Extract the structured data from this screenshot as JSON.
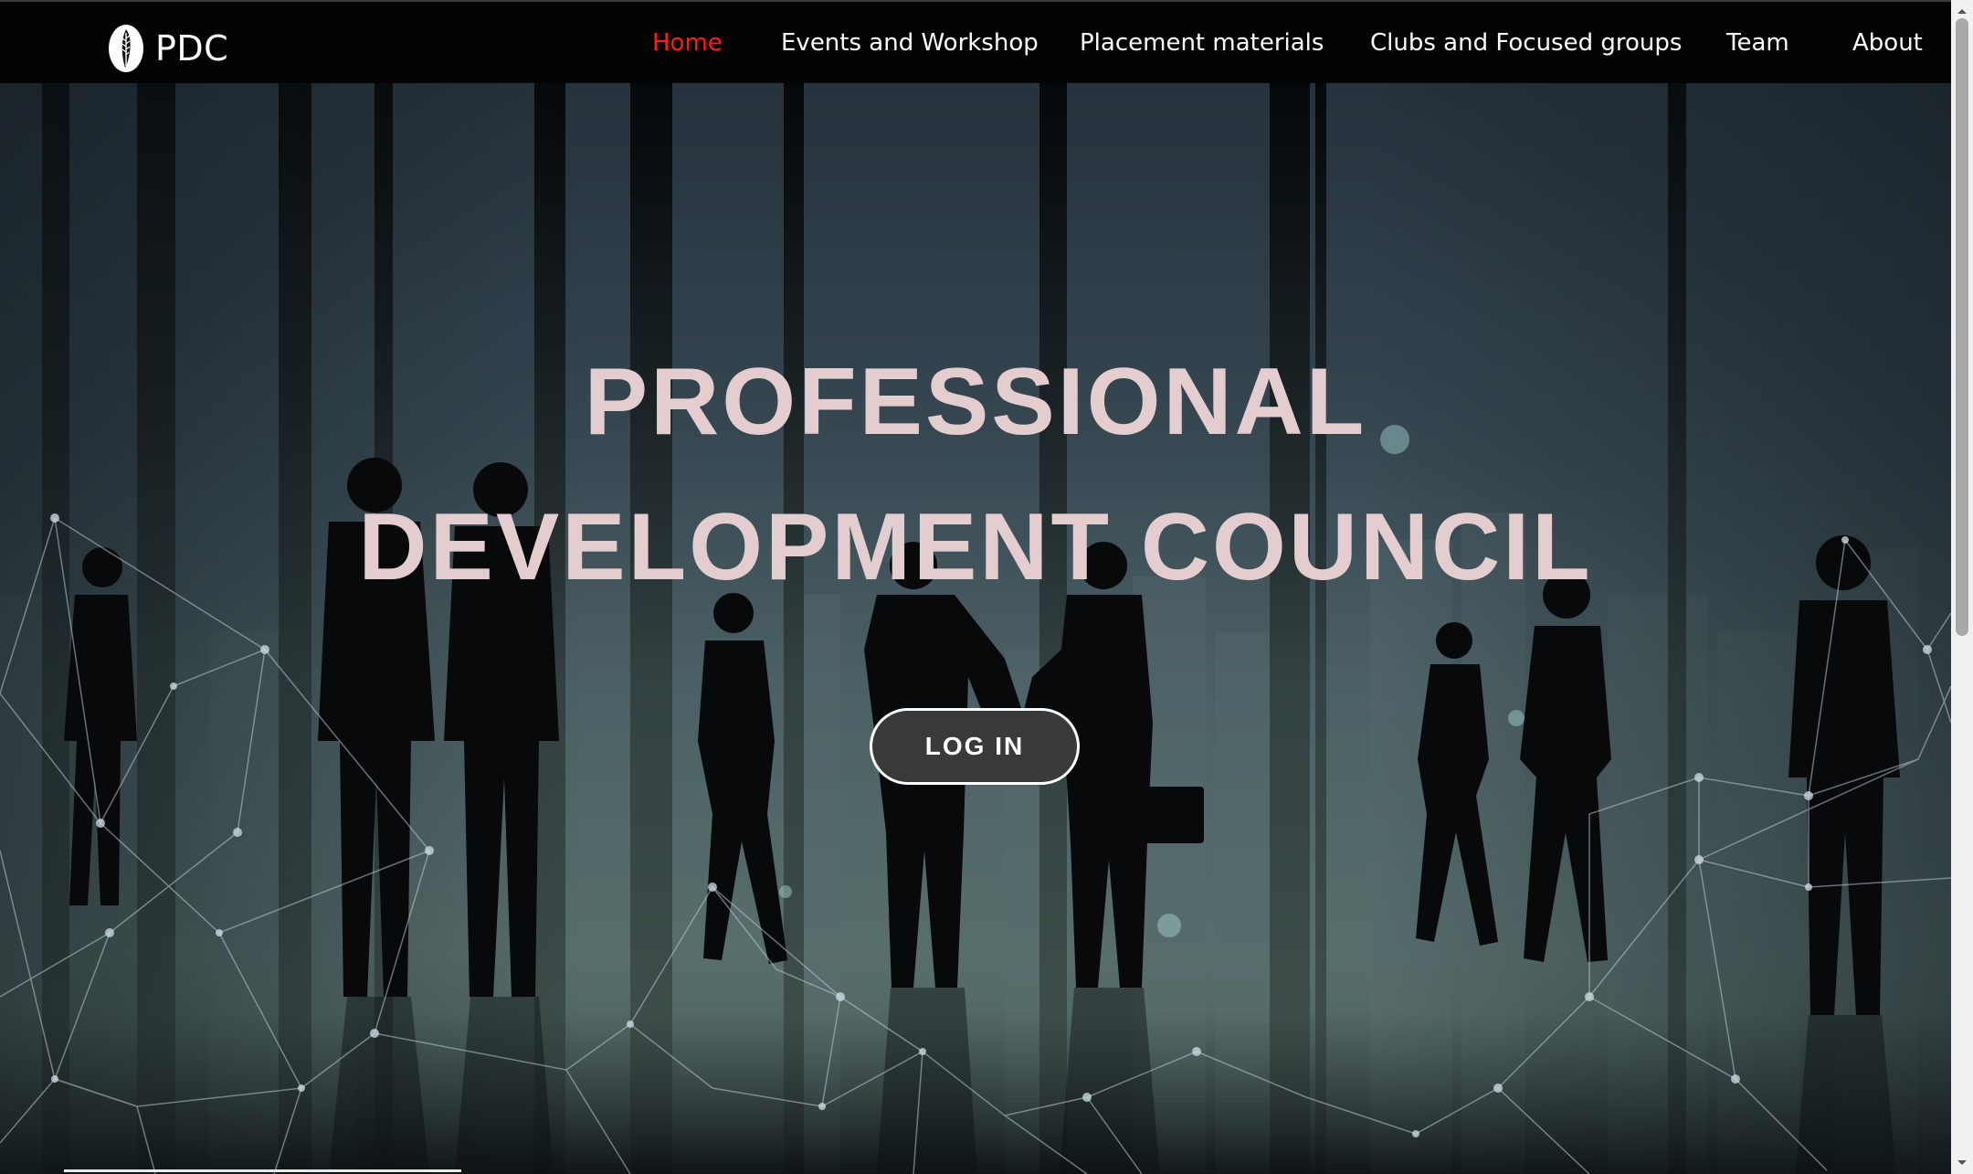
{
  "brand": {
    "name": "PDC",
    "logo_icon": "quill-feather-icon"
  },
  "nav": {
    "items": [
      {
        "label": "Home",
        "active": true
      },
      {
        "label": "Events and Workshop",
        "active": false
      },
      {
        "label": "Placement materials",
        "active": false
      },
      {
        "label": "Clubs and Focused groups",
        "active": false
      },
      {
        "label": "Team",
        "active": false
      },
      {
        "label": "About",
        "active": false
      }
    ]
  },
  "hero": {
    "title_line1": "PROFESSIONAL",
    "title_line2": "DEVELOPMENT COUNCIL",
    "login_label": "LOG IN"
  },
  "colors": {
    "navbar_bg": "#030303",
    "nav_active": "#ff1a1a",
    "nav_text": "#ffffff",
    "title": "#e4cdcf",
    "button_bg": "#3b3a3a"
  }
}
